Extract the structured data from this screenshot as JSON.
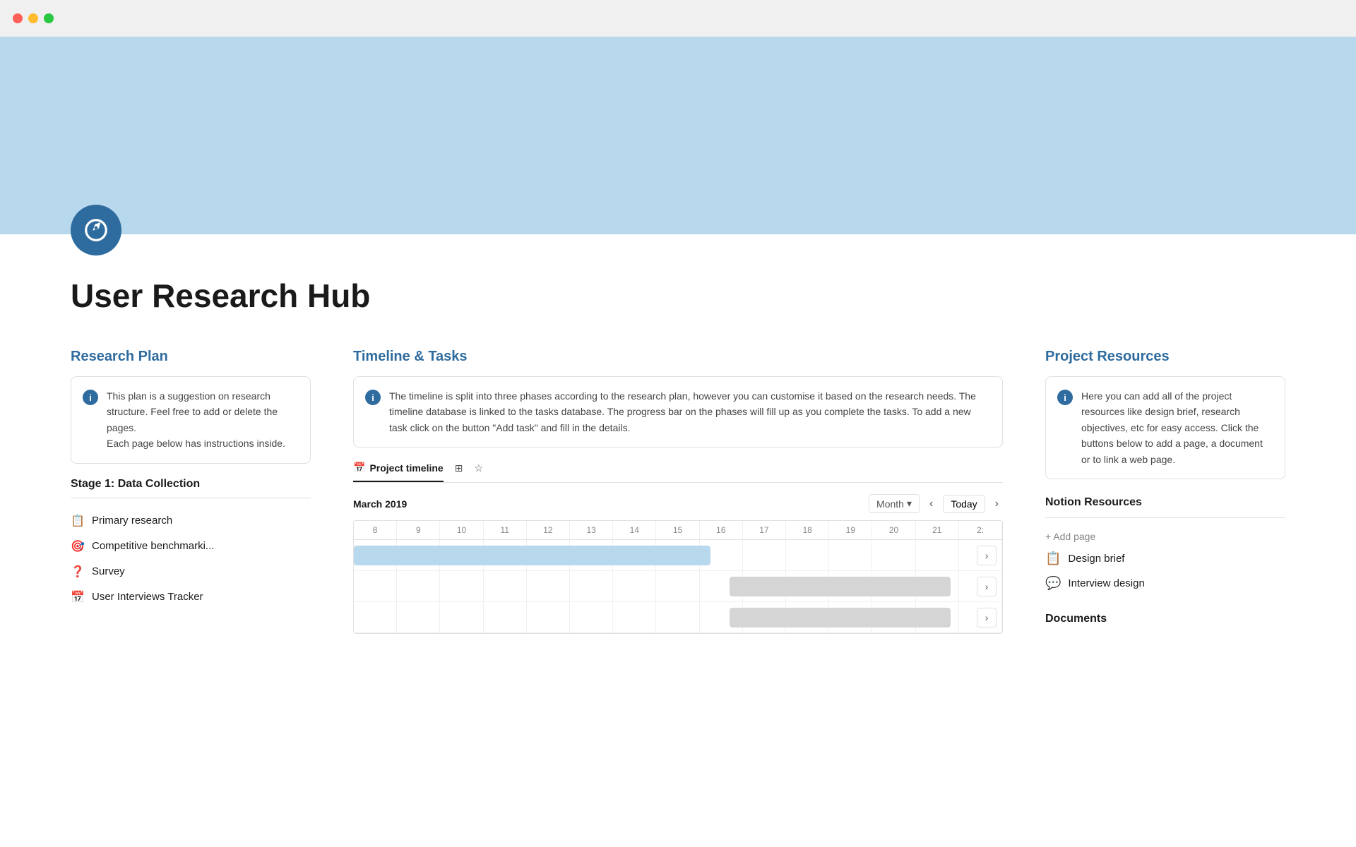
{
  "titlebar": {
    "buttons": [
      "close",
      "minimize",
      "maximize"
    ]
  },
  "hero": {
    "background_color": "#b8d9ed"
  },
  "page": {
    "icon_label": "compass",
    "title": "User Research Hub"
  },
  "research_plan": {
    "heading": "Research Plan",
    "info_card": {
      "text": "This plan is a suggestion on research structure. Feel free to add or delete the pages.\nEach page below has instructions inside."
    },
    "stage1": {
      "label": "Stage 1: Data Collection",
      "items": [
        {
          "icon": "📋",
          "label": "Primary research"
        },
        {
          "icon": "🎯",
          "label": "Competitive benchmarki..."
        },
        {
          "icon": "❓",
          "label": "Survey"
        },
        {
          "icon": "📅",
          "label": "User Interviews Tracker"
        }
      ]
    }
  },
  "timeline_tasks": {
    "heading": "Timeline & Tasks",
    "info_card": {
      "text": "The timeline is split into three phases according to the research plan, however you can customise it based on the research needs. The timeline database is linked to the tasks database. The progress bar on the phases will fill up as you complete the tasks. To add a new task click on the button \"Add task\" and fill in the details."
    },
    "tabs": [
      {
        "label": "Project timeline",
        "active": true
      },
      {
        "label": "grid-icon",
        "active": false
      },
      {
        "label": "star-icon",
        "active": false
      }
    ],
    "date_label": "March 2019",
    "month_button": "Month",
    "today_button": "Today",
    "day_numbers": [
      "8",
      "9",
      "10",
      "11",
      "12",
      "13",
      "14",
      "15",
      "16",
      "17",
      "18",
      "19",
      "20",
      "21",
      "2:"
    ],
    "bars": [
      {
        "type": "blue",
        "left_pct": 0,
        "width_pct": 57
      },
      {
        "type": "gray",
        "left_pct": 59,
        "width_pct": 35
      },
      {
        "type": "gray",
        "left_pct": 59,
        "width_pct": 35
      },
      {
        "type": "gray",
        "left_pct": 59,
        "width_pct": 35
      }
    ]
  },
  "project_resources": {
    "heading": "Project Resources",
    "info_card": {
      "text": "Here you can add all of the project resources like design brief, research objectives, etc for easy access. Click the buttons below to add a page, a document or to link a web page."
    },
    "notion_resources_label": "Notion Resources",
    "add_page_label": "+ Add page",
    "resources": [
      {
        "icon": "📋",
        "label": "Design brief"
      },
      {
        "icon": "💬",
        "label": "Interview design"
      }
    ],
    "documents_label": "Documents"
  }
}
